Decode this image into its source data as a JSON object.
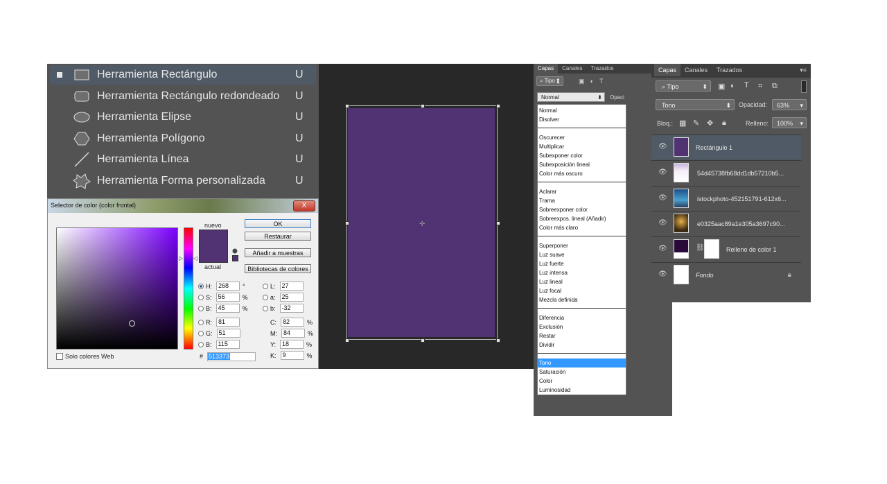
{
  "tools": {
    "items": [
      {
        "label": "Herramienta Rectángulo",
        "key": "U",
        "selected": true,
        "icon": "rectangle-icon"
      },
      {
        "label": "Herramienta Rectángulo redondeado",
        "key": "U",
        "selected": false,
        "icon": "rounded-rectangle-icon"
      },
      {
        "label": "Herramienta Elipse",
        "key": "U",
        "selected": false,
        "icon": "ellipse-icon"
      },
      {
        "label": "Herramienta Polígono",
        "key": "U",
        "selected": false,
        "icon": "polygon-icon"
      },
      {
        "label": "Herramienta Línea",
        "key": "U",
        "selected": false,
        "icon": "line-icon"
      },
      {
        "label": "Herramienta Forma personalizada",
        "key": "U",
        "selected": false,
        "icon": "custom-shape-icon"
      }
    ]
  },
  "picker": {
    "title": "Selector de color (color frontal)",
    "close": "X",
    "new_label": "nuevo",
    "current_label": "actual",
    "ok": "OK",
    "restore": "Restaurar",
    "add_swatches": "Añadir a muestras",
    "libraries": "Bibliotecas de colores",
    "web_only": "Solo colores Web",
    "hex_prefix": "#",
    "hex": "513373",
    "color": "#513373",
    "fields_left": [
      {
        "label": "H:",
        "value": "268",
        "unit": "°",
        "selected": true
      },
      {
        "label": "S:",
        "value": "56",
        "unit": "%",
        "selected": false
      },
      {
        "label": "B:",
        "value": "45",
        "unit": "%",
        "selected": false
      },
      {
        "label": "R:",
        "value": "81",
        "unit": "",
        "selected": false
      },
      {
        "label": "G:",
        "value": "51",
        "unit": "",
        "selected": false
      },
      {
        "label": "B:",
        "value": "115",
        "unit": "",
        "selected": false
      }
    ],
    "fields_right": [
      {
        "label": "L:",
        "value": "27",
        "unit": "",
        "radio": true
      },
      {
        "label": "a:",
        "value": "25",
        "unit": "",
        "radio": true
      },
      {
        "label": "b:",
        "value": "-32",
        "unit": "",
        "radio": true
      },
      {
        "label": "C:",
        "value": "82",
        "unit": "%",
        "radio": false
      },
      {
        "label": "M:",
        "value": "84",
        "unit": "%",
        "radio": false
      },
      {
        "label": "Y:",
        "value": "18",
        "unit": "%",
        "radio": false
      },
      {
        "label": "K:",
        "value": "9",
        "unit": "%",
        "radio": false
      }
    ]
  },
  "layers1": {
    "tabs": [
      "Capas",
      "Canales",
      "Trazados"
    ],
    "filter": "Tipo",
    "blend_mode": "Normal",
    "opacity_label": "Opaci",
    "menu_groups": [
      [
        "Normal",
        "Disolver"
      ],
      [
        "Oscurecer",
        "Multiplicar",
        "Subexponer color",
        "Subexposición lineal",
        "Color más oscuro"
      ],
      [
        "Aclarar",
        "Trama",
        "Sobreexponer color",
        "Sobreexpos. lineal (Añadir)",
        "Color más claro"
      ],
      [
        "Superponer",
        "Luz suave",
        "Luz fuerte",
        "Luz intensa",
        "Luz lineal",
        "Luz focal",
        "Mezcla definida"
      ],
      [
        "Diferencia",
        "Exclusión",
        "Restar",
        "Dividir"
      ],
      [
        "Tono",
        "Saturación",
        "Color",
        "Luminosidad"
      ]
    ],
    "selected_mode": "Tono"
  },
  "layers2": {
    "tabs": [
      "Capas",
      "Canales",
      "Trazados"
    ],
    "filter": "Tipo",
    "blend_mode": "Tono",
    "opacity_label": "Opacidad:",
    "opacity": "63%",
    "lock_label": "Bloq.:",
    "fill_label": "Relleno:",
    "fill": "100%",
    "layers": [
      {
        "name": "Rectángulo 1",
        "selected": true,
        "thumb": "#513373"
      },
      {
        "name": "54d45738fb68dd1db57210b5...",
        "selected": false,
        "thumb": "#d8c8e0"
      },
      {
        "name": "istockphoto-452151791-612x6...",
        "selected": false,
        "thumb": "#3a7fb0"
      },
      {
        "name": "e0325aac89a1e305a3697c90...",
        "selected": false,
        "thumb": "#6a4a20"
      },
      {
        "name": "Relleno de color 1",
        "selected": false,
        "thumb": "#2a0a3a",
        "mask": true
      },
      {
        "name": "Fondo",
        "selected": false,
        "thumb": "#ffffff",
        "locked": true
      }
    ]
  }
}
